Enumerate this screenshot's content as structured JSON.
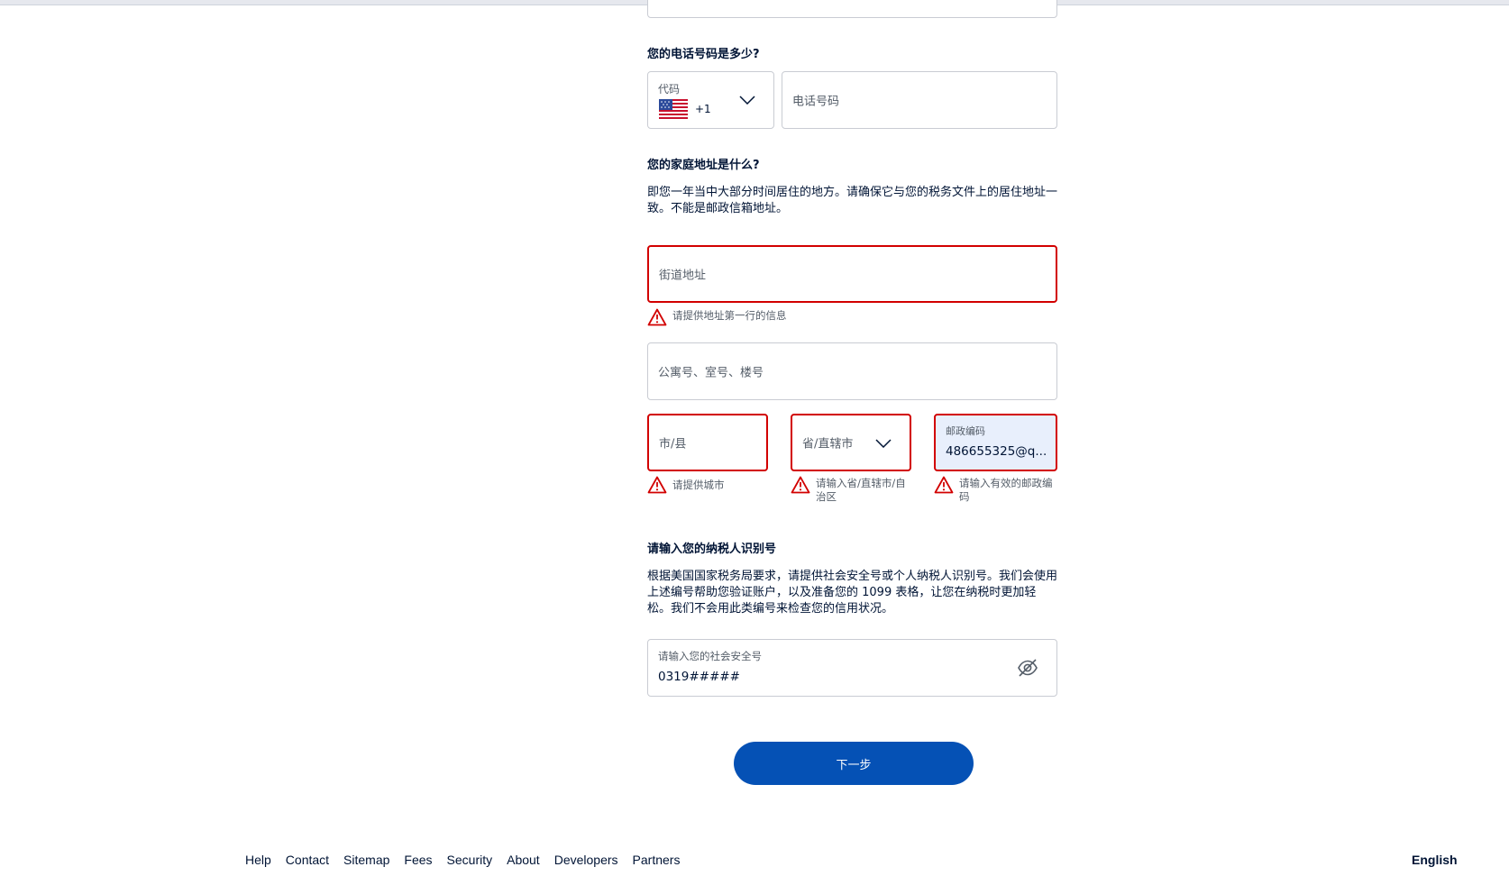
{
  "phone": {
    "heading": "您的电话号码是多少?",
    "code_label": "代码",
    "code_value": "+1",
    "number_placeholder": "电话号码"
  },
  "address": {
    "heading": "您的家庭地址是什么?",
    "description": "即您一年当中大部分时间居住的地方。请确保它与您的税务文件上的居住地址一致。不能是邮政信箱地址。",
    "street_placeholder": "街道地址",
    "street_error": "请提供地址第一行的信息",
    "apt_placeholder": "公寓号、室号、楼号",
    "city_placeholder": "市/县",
    "city_error": "请提供城市",
    "state_placeholder": "省/直辖市",
    "state_error": "请输入省/直辖市/自治区",
    "zip_label": "邮政编码",
    "zip_value": "486655325@q...",
    "zip_error": "请输入有效的邮政编码"
  },
  "tax": {
    "heading": "请输入您的纳税人识别号",
    "description": "根据美国国家税务局要求，请提供社会安全号或个人纳税人识别号。我们会使用上述编号帮助您验证账户，以及准备您的 1099 表格，让您在纳税时更加轻松。我们不会用此类编号来检查您的信用状况。",
    "ssn_label": "请输入您的社会安全号",
    "ssn_value": "0319#####"
  },
  "next_button": "下一步",
  "footer": {
    "links": [
      "Help",
      "Contact",
      "Sitemap",
      "Fees",
      "Security",
      "About",
      "Developers",
      "Partners"
    ],
    "language": "English"
  },
  "colors": {
    "error": "#d20000",
    "primary": "#0551b5"
  },
  "icons": {
    "flag": "us-flag-icon",
    "chevron": "chevron-down-icon",
    "warning": "warning-icon",
    "visibility": "eye-slash-icon"
  }
}
